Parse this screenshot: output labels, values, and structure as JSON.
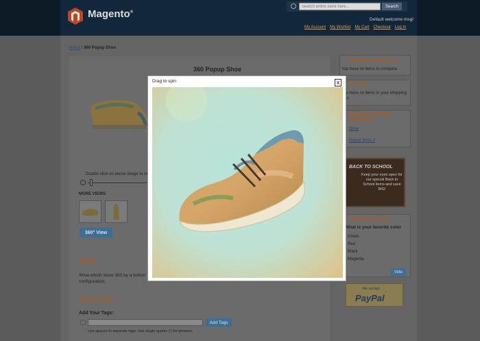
{
  "header": {
    "logo_text": "Magento",
    "logo_mark": "®",
    "search_placeholder": "Search entire store here...",
    "search_button": "Search",
    "welcome": "Default welcome msg!",
    "links": [
      "My Account",
      "My Wishlist",
      "My Cart",
      "Checkout",
      "Log In"
    ]
  },
  "breadcrumb": {
    "home": "Home",
    "separator": "/",
    "current": "360 Popup Shoe"
  },
  "product": {
    "title": "360 Popup Shoe",
    "zoom_hint": "Double click on above image to view full picture",
    "more_views": "MORE VIEWS",
    "view360_button": "360° View",
    "details_title": "Details",
    "details_text": "Shoe which show 360 by a button configuration.",
    "tags_title": "Product Tags",
    "add_tags_label": "Add Your Tags:",
    "add_tags_button": "Add Tags",
    "tags_note": "Use spaces to separate tags. Use single quotes (') for phrases."
  },
  "sidebar": {
    "compare_title": "COMPARE PRODUCTS",
    "compare_text": "You have no items to compare.",
    "cart_title": "MY CART",
    "cart_text": "You have no items in your shopping cart.",
    "recent_title": "RECENTLY VIEWED PRODUCTS",
    "recent_items": [
      "Shoe",
      "Popup Shoe 2"
    ],
    "bts_title": "BACK TO SCHOOL",
    "bts_text": "Keep your eyes open for our special Back to School items and save BIG!",
    "poll_title": "COMMUNITY POLL",
    "poll_question": "What is your favorite color",
    "poll_options": [
      "Green",
      "Red",
      "Black",
      "Magenta"
    ],
    "vote_button": "Vote",
    "paypal_small": "We accept",
    "paypal_logo": "PayPal"
  },
  "popup": {
    "hint": "Drag to spin",
    "close": "x"
  },
  "colors": {
    "accent_orange": "#b35a1a",
    "button_blue": "#3d6e96",
    "header_dark": "#0c1a26"
  },
  "icons": [
    "search-icon",
    "close-icon",
    "tag-icon",
    "zoom-minus-icon"
  ]
}
